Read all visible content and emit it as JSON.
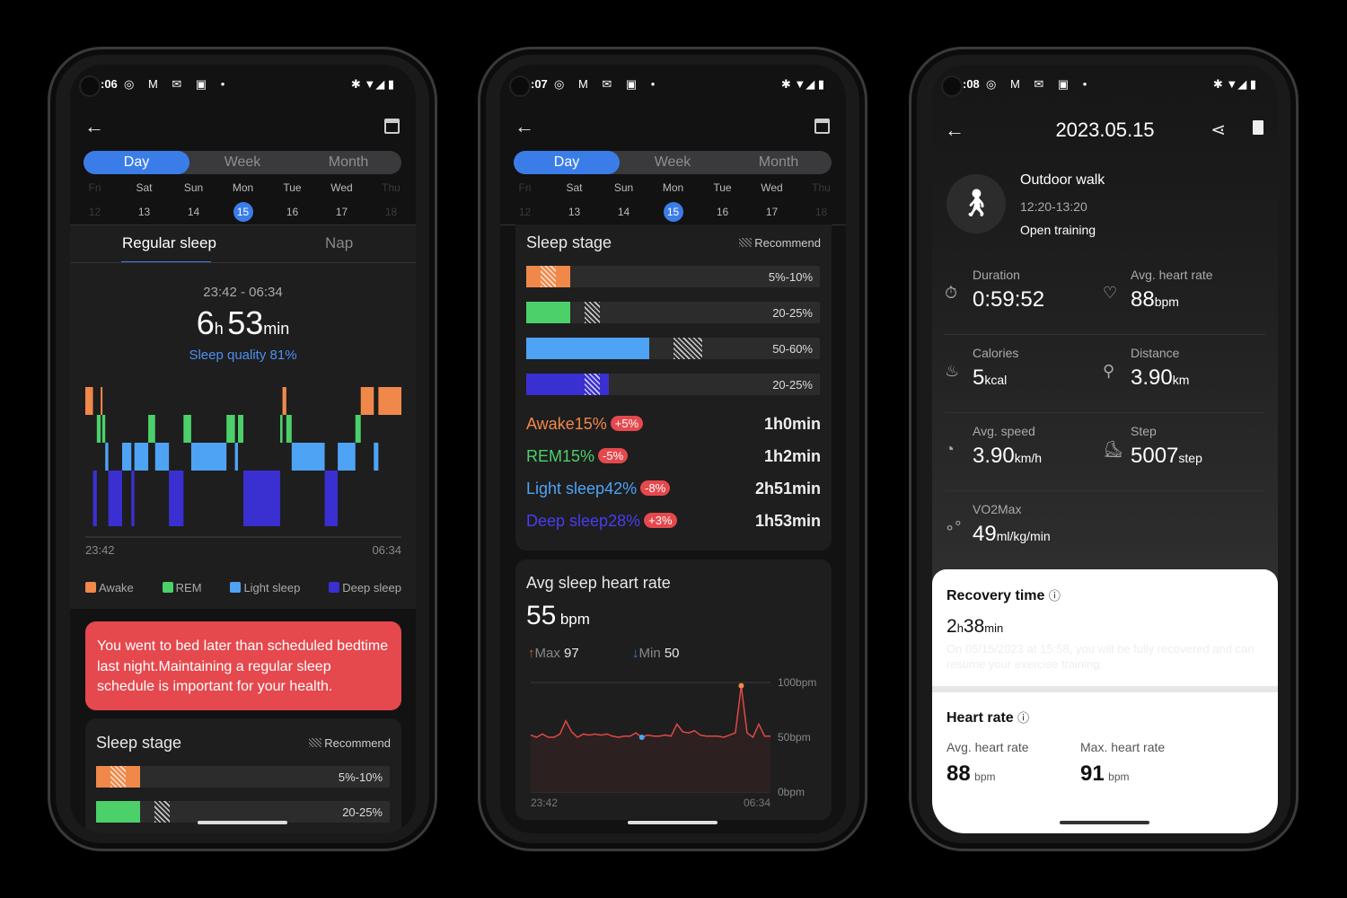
{
  "colors": {
    "accent": "#3b7de8",
    "awake": "#f0884a",
    "rem": "#4cd06a",
    "light": "#4ea3f5",
    "deep": "#3a2fd0",
    "alert": "#e5484d",
    "hr_line": "#e04848"
  },
  "screen1": {
    "status_time": ":06",
    "tabs": [
      "Day",
      "Week",
      "Month"
    ],
    "days": [
      {
        "d": "Fri",
        "n": "12"
      },
      {
        "d": "Sat",
        "n": "13"
      },
      {
        "d": "Sun",
        "n": "14"
      },
      {
        "d": "Mon",
        "n": "15"
      },
      {
        "d": "Tue",
        "n": "16"
      },
      {
        "d": "Wed",
        "n": "17"
      },
      {
        "d": "Thu",
        "n": "18"
      }
    ],
    "sleep_tabs": [
      "Regular sleep",
      "Nap"
    ],
    "time_range": "23:42 - 06:34",
    "hours": "6",
    "h_unit": "h",
    "minutes": "53",
    "m_unit": "min",
    "quality": "Sleep quality 81%",
    "hypnogram": [
      [
        "awake",
        "23:42",
        "23:52"
      ],
      [
        "deep",
        "23:52",
        "23:57"
      ],
      [
        "rem",
        "23:57",
        "00:02"
      ],
      [
        "awake",
        "00:02",
        "00:04"
      ],
      [
        "rem",
        "00:04",
        "00:08"
      ],
      [
        "light",
        "00:08",
        "00:12"
      ],
      [
        "deep",
        "00:12",
        "00:30"
      ],
      [
        "light",
        "00:30",
        "00:42"
      ],
      [
        "deep",
        "00:42",
        "00:46"
      ],
      [
        "light",
        "00:46",
        "01:04"
      ],
      [
        "rem",
        "01:04",
        "01:13"
      ],
      [
        "light",
        "01:13",
        "01:31"
      ],
      [
        "deep",
        "01:31",
        "01:50"
      ],
      [
        "rem",
        "01:50",
        "02:00"
      ],
      [
        "light",
        "02:00",
        "02:46"
      ],
      [
        "rem",
        "02:46",
        "02:57"
      ],
      [
        "light",
        "02:57",
        "03:01"
      ],
      [
        "rem",
        "03:01",
        "03:08"
      ],
      [
        "deep",
        "03:08",
        "03:56"
      ],
      [
        "rem",
        "03:56",
        "03:59"
      ],
      [
        "awake",
        "03:59",
        "04:04"
      ],
      [
        "rem",
        "04:04",
        "04:11"
      ],
      [
        "light",
        "04:11",
        "04:54"
      ],
      [
        "deep",
        "04:54",
        "05:11"
      ],
      [
        "light",
        "05:11",
        "05:34"
      ],
      [
        "rem",
        "05:34",
        "05:41"
      ],
      [
        "awake",
        "05:41",
        "05:58"
      ],
      [
        "light",
        "05:58",
        "06:04"
      ],
      [
        "awake",
        "06:04",
        "06:34"
      ]
    ],
    "axis_start": "23:42",
    "axis_end": "06:34",
    "legend": [
      "Awake",
      "REM",
      "Light sleep",
      "Deep sleep"
    ],
    "alert": "You went to bed later than scheduled bedtime last night.Maintaining a regular sleep schedule is important for your health.",
    "stage_title": "Sleep stage",
    "recommend": "Recommend",
    "stage_rows": [
      {
        "range": "5%-10%"
      },
      {
        "range": "20-25%"
      }
    ]
  },
  "screen2": {
    "status_time": ":07",
    "stage_title": "Sleep stage",
    "recommend": "Recommend",
    "stages": [
      {
        "key": "awake",
        "name": "Awake",
        "pct": 15,
        "rec": [
          5,
          10
        ],
        "range": "5%-10%",
        "diff": "+5%",
        "duration": "1h0min"
      },
      {
        "key": "rem",
        "name": "REM",
        "pct": 15,
        "rec": [
          20,
          25
        ],
        "range": "20-25%",
        "diff": "-5%",
        "duration": "1h2min"
      },
      {
        "key": "light",
        "name": "Light sleep",
        "pct": 42,
        "rec": [
          50,
          60
        ],
        "range": "50-60%",
        "diff": "-8%",
        "duration": "2h51min"
      },
      {
        "key": "deep",
        "name": "Deep sleep",
        "pct": 28,
        "rec": [
          20,
          25
        ],
        "range": "20-25%",
        "diff": "+3%",
        "duration": "1h53min"
      }
    ],
    "hr_title": "Avg sleep heart rate",
    "hr_value": "55",
    "hr_unit": "bpm",
    "max_label": "Max",
    "max_value": "97",
    "min_label": "Min",
    "min_value": "50",
    "chart_data": {
      "type": "line",
      "title": "",
      "x_start": "23:42",
      "x_end": "06:34",
      "yticks": [
        "100bpm",
        "50bpm",
        "0bpm"
      ],
      "ylim": [
        0,
        100
      ],
      "unit": "bpm",
      "values": [
        52,
        50,
        53,
        50,
        50,
        53,
        65,
        55,
        50,
        53,
        52,
        53,
        52,
        53,
        51,
        50,
        51,
        51,
        54,
        50,
        52,
        51,
        51,
        52,
        51,
        62,
        55,
        54,
        56,
        52,
        51,
        51,
        51,
        50,
        52,
        54,
        97,
        54,
        50,
        62,
        51,
        51
      ],
      "max_index": 36,
      "min_index": 19
    }
  },
  "screen3": {
    "status_time": ":08",
    "date": "2023.05.15",
    "workout": "Outdoor walk",
    "workout_time": "12:20-13:20",
    "open": "Open training",
    "stats": [
      {
        "icon": "stopwatch-icon",
        "g": "⏱",
        "label": "Duration",
        "value": "0:59:52",
        "unit": ""
      },
      {
        "icon": "heart-icon",
        "g": "♡",
        "label": "Avg. heart rate",
        "value": "88",
        "unit": "bpm"
      },
      {
        "icon": "flame-icon",
        "g": "♨",
        "label": "Calories",
        "value": "5",
        "unit": "kcal"
      },
      {
        "icon": "distance-icon",
        "g": "⚲",
        "label": "Distance",
        "value": "3.90",
        "unit": "km"
      },
      {
        "icon": "speed-icon",
        "g": "◔",
        "label": "Avg. speed",
        "value": "3.90",
        "unit": "km/h"
      },
      {
        "icon": "shoe-icon",
        "g": "⛸",
        "label": "Step",
        "value": "5007",
        "unit": "step"
      },
      {
        "icon": "vo2-icon",
        "g": "∘°",
        "label": "VO2Max",
        "value": "49",
        "unit": "ml/kg/min"
      }
    ],
    "recovery_title": "Recovery time",
    "rec_h": "2",
    "rec_m": "38",
    "h_unit": "h",
    "m_unit": "min",
    "recovery_note": "On 05/15/2023 at 15:58, you will be fully recovered and can resume your exercise training.",
    "hr_title": "Heart rate",
    "avg_label": "Avg. heart rate",
    "avg": "88",
    "max_label": "Max. heart rate",
    "max": "91",
    "unit": "bpm"
  }
}
